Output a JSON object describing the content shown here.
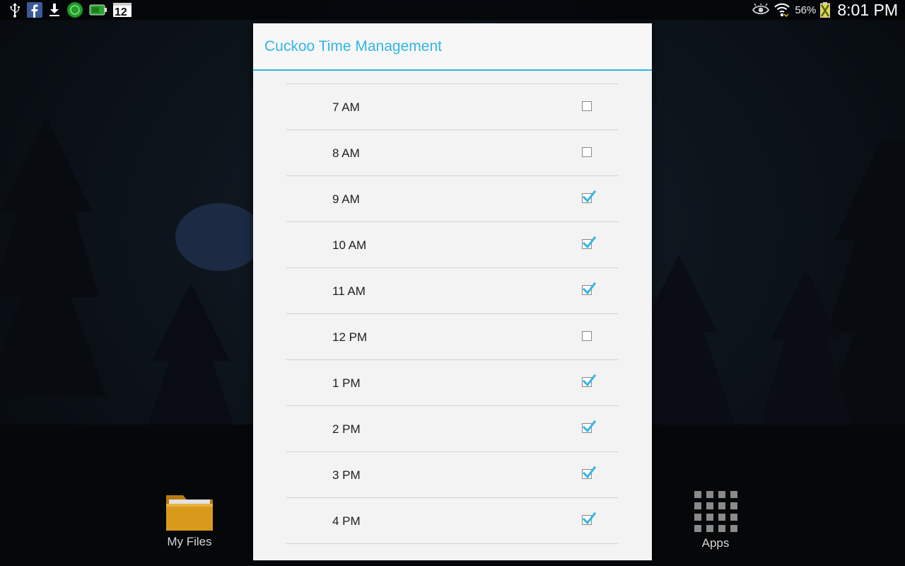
{
  "status_bar": {
    "left_icons": [
      "usb-icon",
      "facebook-icon",
      "download-icon",
      "green-circle-app-icon",
      "green-battery-app-icon",
      "calendar-icon"
    ],
    "calendar_day": "12",
    "right_icons": [
      "eye-icon",
      "wifi-icon",
      "battery-icon"
    ],
    "battery_percent": "56%",
    "clock": "8:01 PM"
  },
  "home": {
    "shortcuts": [
      {
        "label": "My Files",
        "icon": "folder-icon"
      },
      {
        "label": "Apps",
        "icon": "apps-grid-icon"
      }
    ]
  },
  "dialog": {
    "title": "Cuckoo Time Management",
    "title_color": "#33b5e5",
    "items": [
      {
        "label": "7 AM",
        "checked": false
      },
      {
        "label": "8 AM",
        "checked": false
      },
      {
        "label": "9 AM",
        "checked": true
      },
      {
        "label": "10 AM",
        "checked": true
      },
      {
        "label": "11 AM",
        "checked": true
      },
      {
        "label": "12 PM",
        "checked": false
      },
      {
        "label": "1 PM",
        "checked": true
      },
      {
        "label": "2 PM",
        "checked": true
      },
      {
        "label": "3 PM",
        "checked": true
      },
      {
        "label": "4 PM",
        "checked": true
      }
    ]
  }
}
